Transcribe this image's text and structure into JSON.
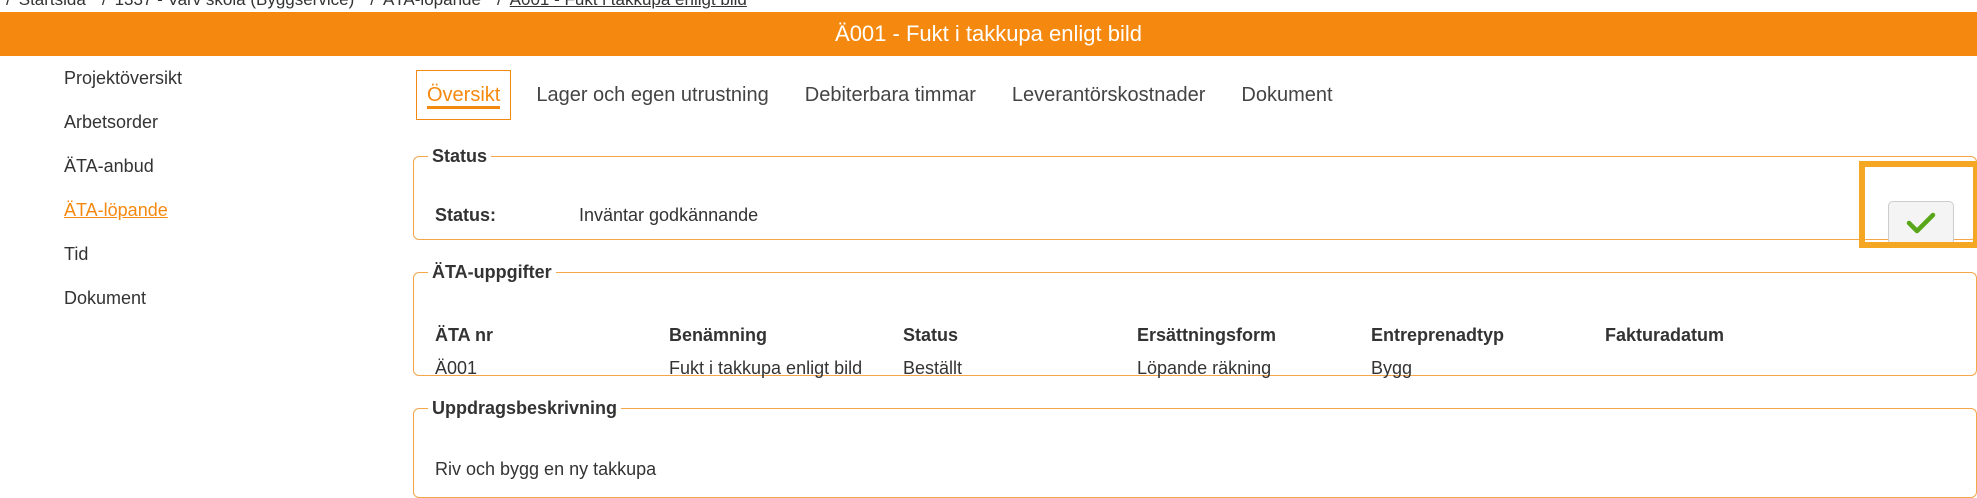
{
  "breadcrumb": {
    "items": [
      "Startsida",
      "1337 - Varv skola (Byggservice)",
      "ÄTA-löpande",
      "Ä001 - Fukt i takkupa enligt bild"
    ],
    "separator": "/"
  },
  "header": {
    "title": "Ä001 - Fukt i takkupa enligt bild"
  },
  "sidebar": {
    "items": [
      {
        "label": "Projektöversikt"
      },
      {
        "label": "Arbetsorder"
      },
      {
        "label": "ÄTA-anbud"
      },
      {
        "label": "ÄTA-löpande"
      },
      {
        "label": "Tid"
      },
      {
        "label": "Dokument"
      }
    ],
    "active_index": 3
  },
  "tabs": [
    {
      "label": "Översikt"
    },
    {
      "label": "Lager och egen utrustning"
    },
    {
      "label": "Debiterbara timmar"
    },
    {
      "label": "Leverantörskostnader"
    },
    {
      "label": "Dokument"
    }
  ],
  "status_section": {
    "legend": "Status",
    "label": "Status:",
    "value": "Inväntar godkännande",
    "confirm_icon": "checkmark-icon"
  },
  "ata_section": {
    "legend": "ÄTA-uppgifter",
    "headers": [
      "ÄTA nr",
      "Benämning",
      "Status",
      "Ersättningsform",
      "Entreprenadtyp",
      "Fakturadatum"
    ],
    "values": [
      "Ä001",
      "Fukt i takkupa enligt bild",
      "Beställt",
      "Löpande räkning",
      "Bygg",
      ""
    ]
  },
  "description_section": {
    "legend": "Uppdragsbeskrivning",
    "text": "Riv och bygg en ny takkupa"
  },
  "colors": {
    "accent": "#f5890f",
    "check_green": "#5aa61a",
    "highlight": "#f5a623"
  }
}
